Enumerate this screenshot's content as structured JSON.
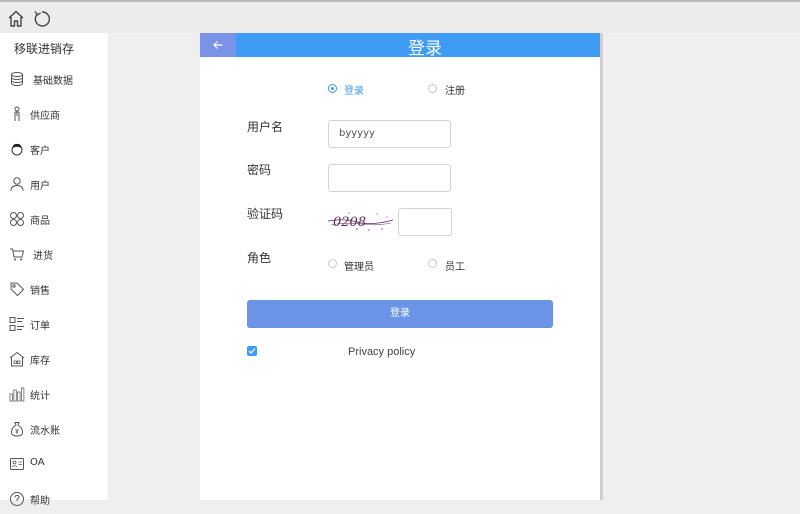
{
  "toolbar": {
    "home_icon": "home-icon",
    "refresh_icon": "refresh-icon"
  },
  "sidebar": {
    "app_title": "移联进销存",
    "items": [
      {
        "label": "基础数据",
        "icon": "database-icon"
      },
      {
        "label": "供应商",
        "icon": "supplier-icon"
      },
      {
        "label": "客户",
        "icon": "customer-icon"
      },
      {
        "label": "用户",
        "icon": "user-icon"
      },
      {
        "label": "商品",
        "icon": "goods-icon"
      },
      {
        "label": "进货",
        "icon": "cart-icon"
      },
      {
        "label": "销售",
        "icon": "tag-icon"
      },
      {
        "label": "订单",
        "icon": "order-list-icon"
      },
      {
        "label": "库存",
        "icon": "warehouse-icon"
      },
      {
        "label": "统计",
        "icon": "stats-icon"
      },
      {
        "label": "流水账",
        "icon": "money-bag-icon"
      },
      {
        "label": "OA",
        "icon": "id-card-icon"
      },
      {
        "label": "帮助",
        "icon": "help-icon"
      }
    ]
  },
  "login": {
    "header_title": "登录",
    "mode": {
      "login_label": "登录",
      "register_label": "注册",
      "selected": "登录"
    },
    "username_label": "用户名",
    "username_value": "byyyyy",
    "password_label": "密码",
    "captcha_label": "验证码",
    "captcha_text": "0208",
    "role_label": "角色",
    "role_options": [
      "管理员",
      "员工"
    ],
    "submit_label": "登录",
    "privacy_text": "Privacy policy",
    "privacy_checked": true
  },
  "colors": {
    "accent": "#3f9cf6",
    "button": "#6b93e6",
    "back_button": "#7a93e6"
  }
}
